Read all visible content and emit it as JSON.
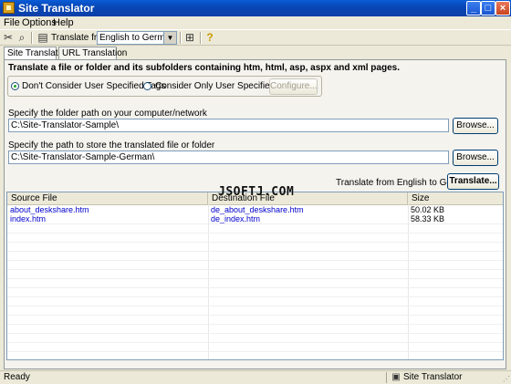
{
  "window": {
    "title": "Site Translator"
  },
  "menu": [
    "File",
    "Options",
    "Help"
  ],
  "toolbar": {
    "translate_from_label": "Translate from",
    "translate_from_value": "English to German",
    "icons": [
      "tools-icon",
      "search-document-icon",
      "page-icon",
      "toolbar-button-icon",
      "help-bulb-icon"
    ]
  },
  "tabs": [
    {
      "label": "Site Translation",
      "active": true
    },
    {
      "label": "URL Translation",
      "active": false
    }
  ],
  "description": "Translate a file or folder and its subfolders containing htm, html, asp, aspx and xml pages.",
  "options": {
    "radio_dont_consider": "Don't Consider User Specified Tags",
    "radio_consider_only": "Consider Only  User Specified Tags",
    "configure_label": "Configure..."
  },
  "source": {
    "label": "Specify the folder path on your computer/network",
    "value": "C:\\Site-Translator-Sample\\",
    "browse": "Browse..."
  },
  "dest": {
    "label": "Specify the path to store the translated file or folder",
    "value": "C:\\Site-Translator-Sample-German\\",
    "browse": "Browse..."
  },
  "translate": {
    "status": "Translate from English to German",
    "button": "Translate..."
  },
  "table": {
    "columns": [
      "Source File",
      "Destination File",
      "Size"
    ],
    "rows": [
      [
        "about_deskshare.htm",
        "de_about_deskshare.htm",
        "50.02 KB"
      ],
      [
        "index.htm",
        "de_index.htm",
        "58.33 KB"
      ]
    ]
  },
  "watermark": "JSOFTJ.COM",
  "status": {
    "left": "Ready",
    "right": "Site Translator"
  },
  "colors": {
    "titlebar": "#0847b6",
    "link": "#0000cc",
    "background": "#ece9d8"
  }
}
